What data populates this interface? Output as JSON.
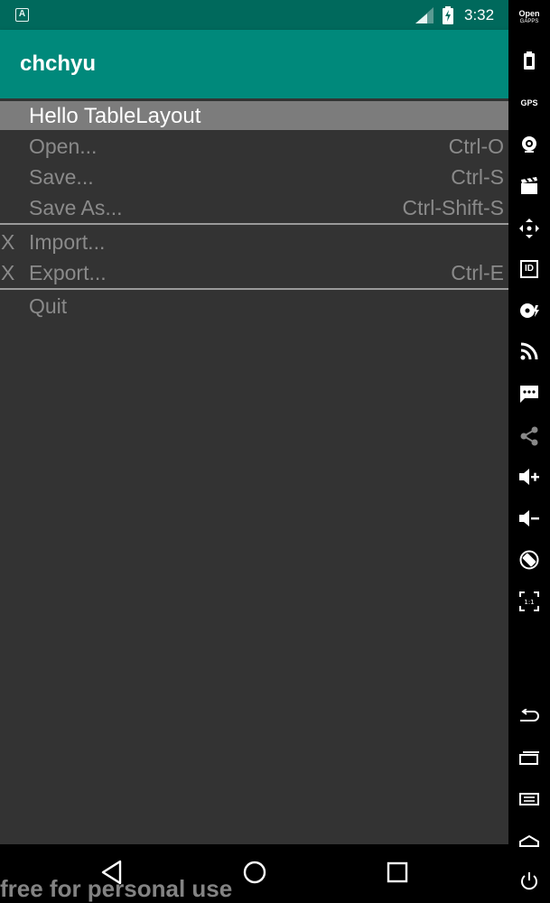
{
  "status_bar": {
    "notification_icon_letter": "A",
    "time": "3:32",
    "icons": [
      "notification-a-icon",
      "signal-icon",
      "battery-charging-icon"
    ]
  },
  "app_bar": {
    "title": "chchyu"
  },
  "table": {
    "header": "Hello TableLayout",
    "rows": [
      {
        "mark": "",
        "label": "Open...",
        "shortcut": "Ctrl-O"
      },
      {
        "mark": "",
        "label": "Save...",
        "shortcut": "Ctrl-S"
      },
      {
        "mark": "",
        "label": "Save As...",
        "shortcut": "Ctrl-Shift-S"
      },
      {
        "mark": "X",
        "label": "Import...",
        "shortcut": ""
      },
      {
        "mark": "X",
        "label": "Export...",
        "shortcut": "Ctrl-E"
      },
      {
        "mark": "",
        "label": "Quit",
        "shortcut": ""
      }
    ]
  },
  "nav_bar": {
    "buttons": [
      "back-icon",
      "home-icon",
      "recents-icon"
    ]
  },
  "watermark": "free for personal use",
  "emulator_toolbar": {
    "logo_line1": "Open",
    "logo_line2": "GAPPS",
    "gps_label": "GPS",
    "id_label": "ID",
    "scale_label": "1:1",
    "buttons": [
      "opengapps-icon",
      "battery-icon",
      "gps-icon",
      "camera-icon",
      "media-icon",
      "move-icon",
      "id-icon",
      "disk-icon",
      "rss-icon",
      "sms-icon",
      "share-icon",
      "volume-up-icon",
      "volume-down-icon",
      "rotate-icon",
      "fullscreen-icon",
      "back-icon",
      "recents-icon",
      "menu-icon",
      "home-icon",
      "power-icon"
    ]
  },
  "colors": {
    "status_bar": "#00695c",
    "app_bar": "#00897b",
    "background": "#333333",
    "header_row": "#7c7c7c",
    "row_text": "#8a8a8a"
  }
}
